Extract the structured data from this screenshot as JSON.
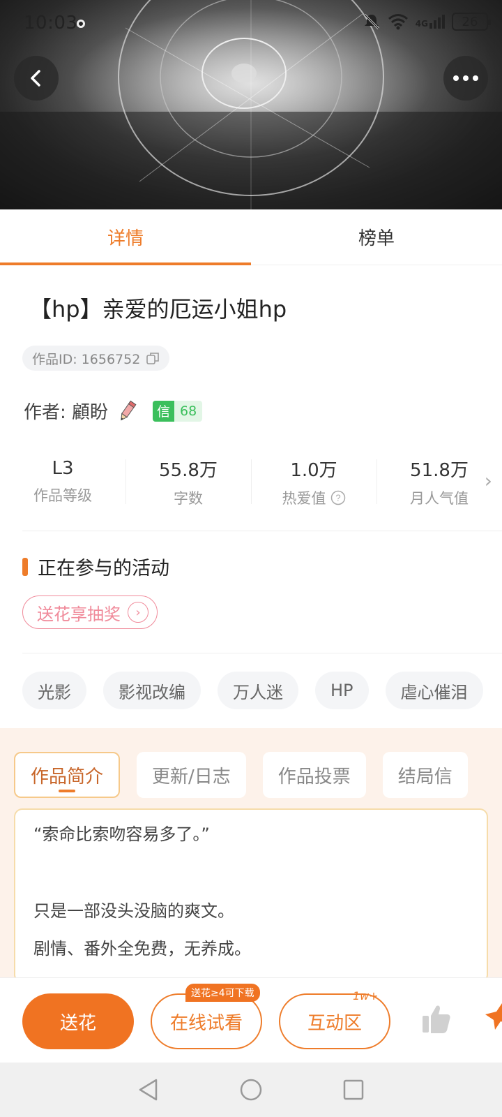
{
  "status": {
    "time": "10:03",
    "network": "4G",
    "battery": "26"
  },
  "tabs": [
    {
      "label": "详情"
    },
    {
      "label": "榜单"
    }
  ],
  "book": {
    "title": "【hp】亲爱的厄运小姐hp",
    "id_label": "作品ID: 1656752",
    "author_label": "作者: 顧盼",
    "credit_badge": "信",
    "credit_value": "68"
  },
  "stats": [
    {
      "value": "L3",
      "label": "作品等级"
    },
    {
      "value": "55.8万",
      "label": "字数"
    },
    {
      "value": "1.0万",
      "label": "热爱值"
    },
    {
      "value": "51.8万",
      "label": "月人气值"
    }
  ],
  "activity": {
    "section_title": "正在参与的活动",
    "pill": "送花享抽奖"
  },
  "tags": [
    "光影",
    "影视改编",
    "万人迷",
    "HP",
    "虐心催泪"
  ],
  "subtabs": [
    {
      "label": "作品简介"
    },
    {
      "label": "更新/日志"
    },
    {
      "label": "作品投票"
    },
    {
      "label": "结局信"
    }
  ],
  "intro": {
    "line1": "“索命比索吻容易多了。”",
    "line2": "只是一部没头没脑的爽文。",
    "line3": "剧情、番外全免费，无养成。"
  },
  "actions": {
    "flower": "送花",
    "read": "在线试看",
    "read_badge": "送花≥4可下载",
    "interact": "互动区",
    "interact_count": "1w+"
  },
  "colors": {
    "accent": "#ee7c2a",
    "primary_button": "#f07322",
    "credit_green": "#3bbf5c",
    "activity_pink": "#f08a9a"
  }
}
